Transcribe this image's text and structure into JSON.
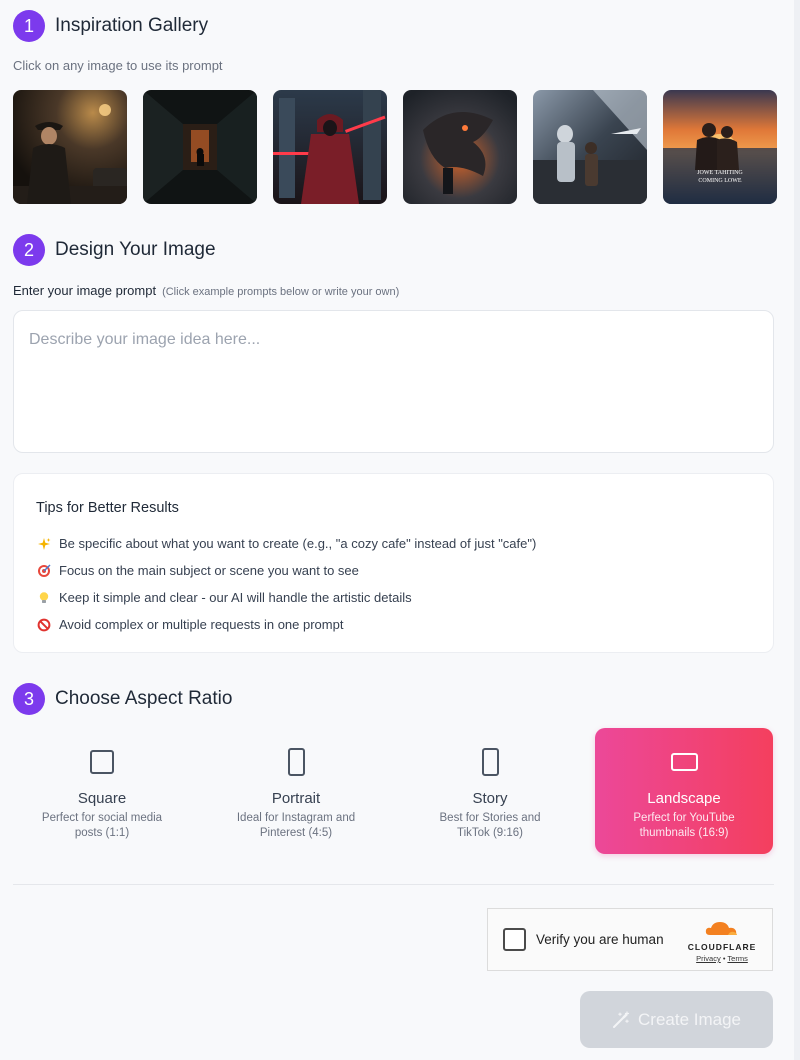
{
  "gallery": {
    "step": "1",
    "title": "Inspiration Gallery",
    "subtitle": "Click on any image to use its prompt",
    "poster_lines": [
      "JOWE TAHITING",
      "COMING LOWE"
    ]
  },
  "design": {
    "step": "2",
    "title": "Design Your Image",
    "prompt_label": "Enter your image prompt",
    "prompt_hint": "(Click example prompts below or write your own)",
    "prompt_placeholder": "Describe your image idea here...",
    "prompt_value": ""
  },
  "tips": {
    "title": "Tips for Better Results",
    "items": [
      {
        "icon": "sparkles-icon",
        "text": "Be specific about what you want to create (e.g., \"a cozy cafe\" instead of just \"cafe\")"
      },
      {
        "icon": "target-icon",
        "text": "Focus on the main subject or scene you want to see"
      },
      {
        "icon": "lightbulb-icon",
        "text": "Keep it simple and clear - our AI will handle the artistic details"
      },
      {
        "icon": "prohibited-icon",
        "text": "Avoid complex or multiple requests in one prompt"
      }
    ]
  },
  "aspect": {
    "step": "3",
    "title": "Choose Aspect Ratio",
    "selected": "Landscape",
    "options": [
      {
        "name": "Square",
        "desc": "Perfect for social media posts (1:1)"
      },
      {
        "name": "Portrait",
        "desc": "Ideal for Instagram and Pinterest (4:5)"
      },
      {
        "name": "Story",
        "desc": "Best for Stories and TikTok (9:16)"
      },
      {
        "name": "Landscape",
        "desc": "Perfect for YouTube thumbnails (16:9)"
      }
    ]
  },
  "captcha": {
    "label": "Verify you are human",
    "brand": "CLOUDFLARE",
    "privacy": "Privacy",
    "separator": "•",
    "terms": "Terms"
  },
  "create_button": {
    "label": "Create Image",
    "enabled": false
  },
  "colors": {
    "step_badge": "#7c3aed",
    "selected_gradient_start": "#ec4899",
    "selected_gradient_end": "#f43f5e",
    "cloudflare_orange": "#f38020",
    "disabled_button": "#d1d5db"
  }
}
